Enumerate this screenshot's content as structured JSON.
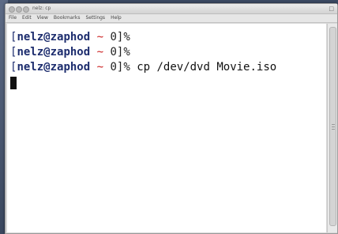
{
  "window": {
    "title": "nelz: cp",
    "corner_glyph": "□"
  },
  "menu": [
    "File",
    "Edit",
    "View",
    "Bookmarks",
    "Settings",
    "Help"
  ],
  "terminal": {
    "lines": [
      {
        "open": "[",
        "user": "nelz@zaphod",
        "tilde": "~",
        "num": "0",
        "close": "]%",
        "cmd": ""
      },
      {
        "open": "[",
        "user": "nelz@zaphod",
        "tilde": "~",
        "num": "0",
        "close": "]%",
        "cmd": ""
      },
      {
        "open": "[",
        "user": "nelz@zaphod",
        "tilde": "~",
        "num": "0",
        "close": "]%",
        "cmd": " cp /dev/dvd Movie.iso"
      }
    ]
  },
  "colors": {
    "prompt": "#1d2d6e",
    "tilde": "#cc2222",
    "background": "#ffffff"
  }
}
